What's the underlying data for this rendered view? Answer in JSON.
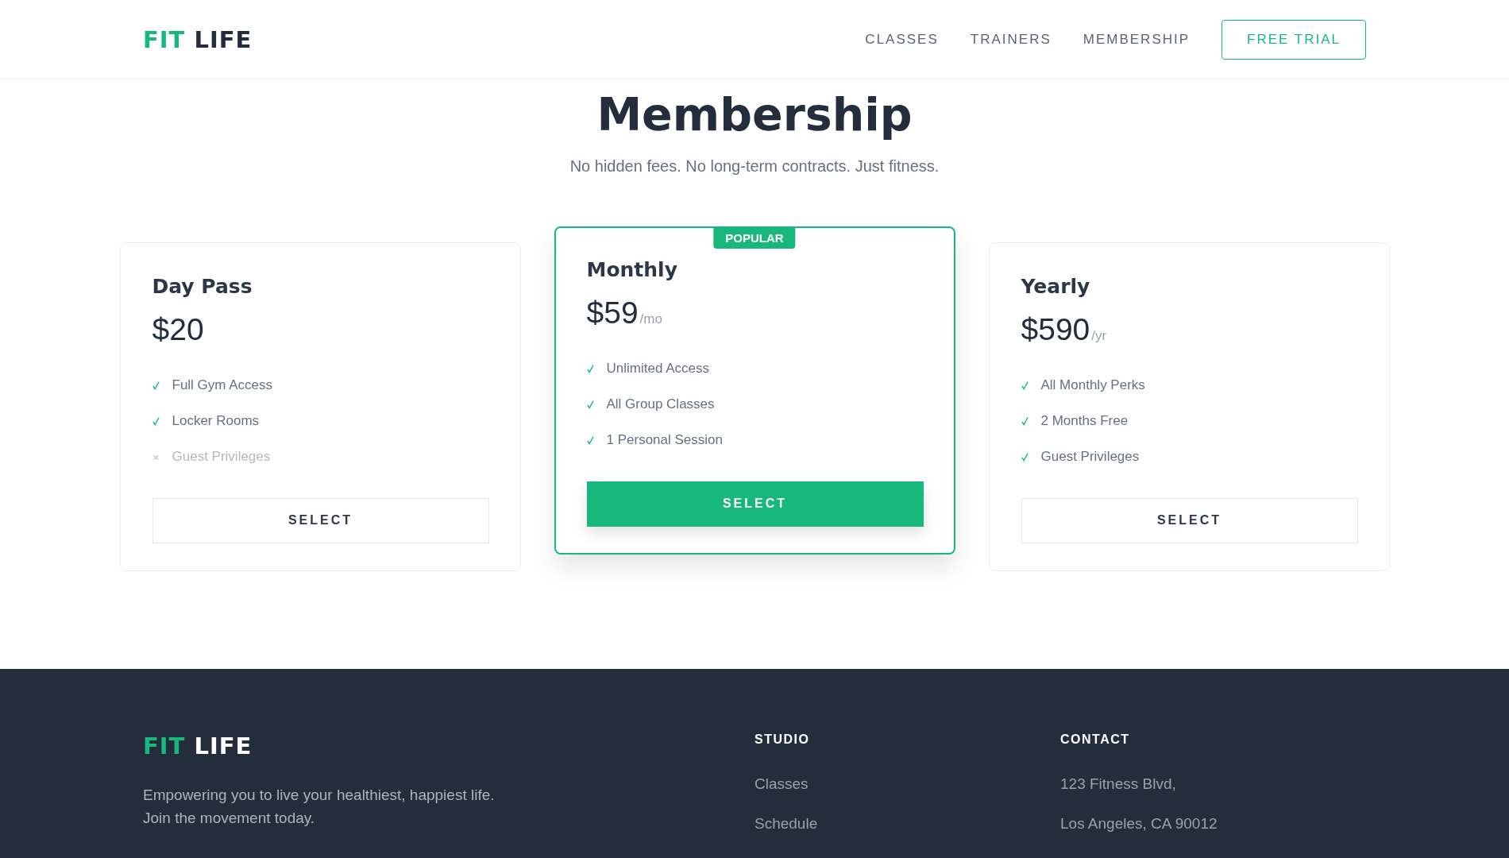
{
  "header": {
    "logo": {
      "accent": "FIT",
      "rest": "LIFE"
    },
    "nav": [
      {
        "label": "CLASSES",
        "kind": "link"
      },
      {
        "label": "TRAINERS",
        "kind": "link"
      },
      {
        "label": "MEMBERSHIP",
        "kind": "link"
      },
      {
        "label": "FREE TRIAL",
        "kind": "button"
      }
    ]
  },
  "hero": {
    "title": "Membership",
    "subtitle": "No hidden fees. No long-term contracts. Just fitness."
  },
  "plans": [
    {
      "name": "Day Pass",
      "price": "$20",
      "featured": false,
      "features": [
        {
          "label": "Full Gym Access",
          "included": true
        },
        {
          "label": "Locker Rooms",
          "included": true
        },
        {
          "label": "Guest Privileges",
          "included": false
        }
      ],
      "button": "SELECT"
    },
    {
      "name": "Monthly",
      "price": "$59",
      "period": "/mo",
      "featured": true,
      "badge": "POPULAR",
      "features": [
        {
          "label": "Unlimited Access",
          "included": true
        },
        {
          "label": "All Group Classes",
          "included": true
        },
        {
          "label": "1 Personal Session",
          "included": true
        }
      ],
      "button": "SELECT"
    },
    {
      "name": "Yearly",
      "price": "$590",
      "period": "/yr",
      "featured": false,
      "features": [
        {
          "label": "All Monthly Perks",
          "included": true
        },
        {
          "label": "2 Months Free",
          "included": true
        },
        {
          "label": "Guest Privileges",
          "included": true
        }
      ],
      "button": "SELECT"
    }
  ],
  "footer": {
    "logo": {
      "accent": "FIT",
      "rest": "LIFE"
    },
    "tagline": "Empowering you to live your healthiest, happiest life. Join the movement today.",
    "columns": [
      {
        "heading": "STUDIO",
        "lines": [
          "Classes",
          "Schedule"
        ]
      },
      {
        "heading": "CONTACT",
        "lines": [
          "123 Fitness Blvd,",
          "Los Angeles, CA 90012"
        ]
      }
    ]
  }
}
